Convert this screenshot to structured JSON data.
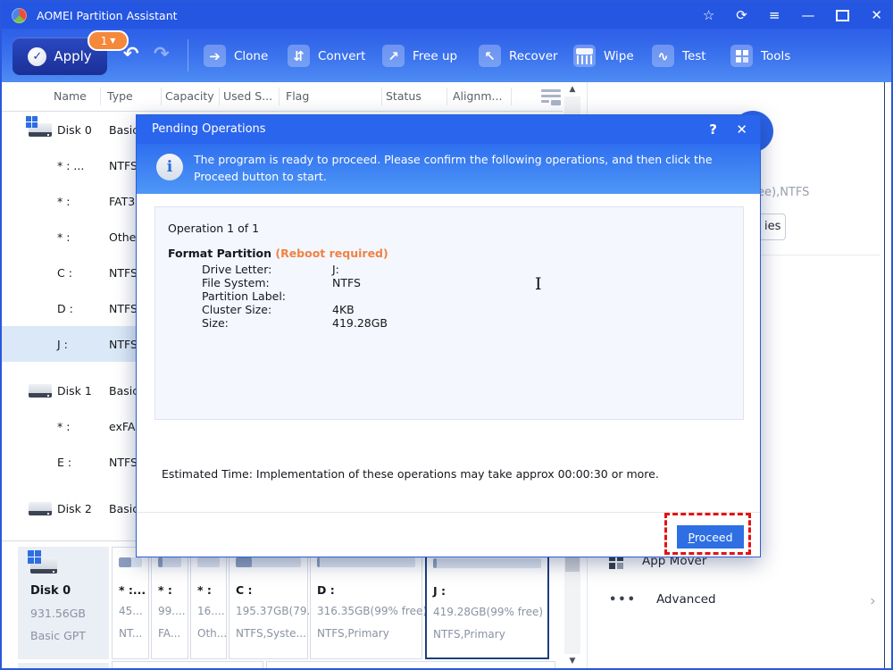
{
  "window": {
    "title": "AOMEI Partition Assistant"
  },
  "titlebar_icons": [
    "favorite-star-icon",
    "refresh-icon",
    "menu-icon",
    "minimize-icon",
    "maximize-icon",
    "close-icon"
  ],
  "toolbar": {
    "apply_label": "Apply",
    "apply_badge": "1",
    "buttons": [
      {
        "label": "Clone",
        "icon": "clone-icon"
      },
      {
        "label": "Convert",
        "icon": "convert-icon"
      },
      {
        "label": "Free up",
        "icon": "free-up-icon"
      },
      {
        "label": "Recover",
        "icon": "recover-icon"
      },
      {
        "label": "Wipe",
        "icon": "wipe-icon"
      },
      {
        "label": "Test",
        "icon": "test-icon"
      },
      {
        "label": "Tools",
        "icon": "tools-icon"
      }
    ]
  },
  "table": {
    "headers": [
      "Name",
      "Type",
      "Capacity",
      "Used S...",
      "Flag",
      "Status",
      "Alignm..."
    ],
    "rows": [
      {
        "name": "Disk 0",
        "type": "Basic",
        "kind": "disk"
      },
      {
        "name": "* : ...",
        "type": "NTFS",
        "kind": "partition"
      },
      {
        "name": "* :",
        "type": "FAT3",
        "kind": "partition"
      },
      {
        "name": "* :",
        "type": "Othe",
        "kind": "partition"
      },
      {
        "name": "C :",
        "type": "NTFS",
        "kind": "partition"
      },
      {
        "name": "D :",
        "type": "NTFS",
        "kind": "partition"
      },
      {
        "name": "J :",
        "type": "NTFS",
        "kind": "partition",
        "selected": true
      },
      {
        "name": "Disk 1",
        "type": "Basic",
        "kind": "disk"
      },
      {
        "name": "* :",
        "type": "exFA",
        "kind": "partition"
      },
      {
        "name": "E :",
        "type": "NTFS",
        "kind": "partition"
      },
      {
        "name": "Disk 2",
        "type": "Basic",
        "kind": "disk"
      }
    ]
  },
  "dialog": {
    "title": "Pending Operations",
    "help_glyph": "?",
    "close_glyph": "✕",
    "message": "The program is ready to proceed. Please confirm the following operations,  and then click the Proceed button to start.",
    "operation_header": "Operation 1 of 1",
    "operation_name": "Format Partition",
    "reboot_note": " (Reboot required)",
    "details": [
      {
        "label": "Drive Letter:",
        "value": "J:"
      },
      {
        "label": "File System:",
        "value": "NTFS"
      },
      {
        "label": "Partition Label:",
        "value": ""
      },
      {
        "label": "Cluster Size:",
        "value": "4KB"
      },
      {
        "label": "Size:",
        "value": "419.28GB"
      }
    ],
    "estimated_time": "Estimated Time: Implementation of these operations may take approx 00:00:30 or more.",
    "proceed_label": "Proceed"
  },
  "disk_panel": {
    "disk": {
      "name": "Disk 0",
      "capacity": "931.56GB",
      "style": "Basic GPT"
    },
    "partitions": [
      {
        "name": "* :...",
        "size": "45...",
        "fs": "NT...",
        "used": 0.55
      },
      {
        "name": "* :",
        "size": "99....",
        "fs": "FA...",
        "used": 0.2
      },
      {
        "name": "* :",
        "size": "16....",
        "fs": "Oth...",
        "used": 0
      },
      {
        "name": "C :",
        "size": "195.37GB(79...",
        "fs": "NTFS,Syste...",
        "used": 0.25
      },
      {
        "name": "D :",
        "size": "316.35GB(99% free)",
        "fs": "NTFS,Primary",
        "used": 0.03
      },
      {
        "name": "J :",
        "size": "419.28GB(99% free)",
        "fs": "NTFS,Primary",
        "used": 0.03,
        "selected": true
      }
    ]
  },
  "sidebar": {
    "fragment_text": "ee),NTFS",
    "fragment_button": "ies",
    "items": [
      {
        "label": "App Mover",
        "icon": "app-mover-icon"
      },
      {
        "label": "Advanced",
        "icon": "advanced-dots-icon",
        "chevron": "›"
      }
    ]
  },
  "colors": {
    "titlebar_blue": "#2456e2",
    "toolbar_blue": "#3c74ee",
    "apply_navy": "#1b2f96",
    "badge_orange": "#f5883a",
    "dialog_header_blue": "#2a65ee",
    "proceed_blue": "#2e6fe4",
    "reboot_orange": "#f08243",
    "annotation_red": "#e31212",
    "selected_row": "#dbe8f7",
    "selected_partition_border": "#1c3f7e"
  }
}
